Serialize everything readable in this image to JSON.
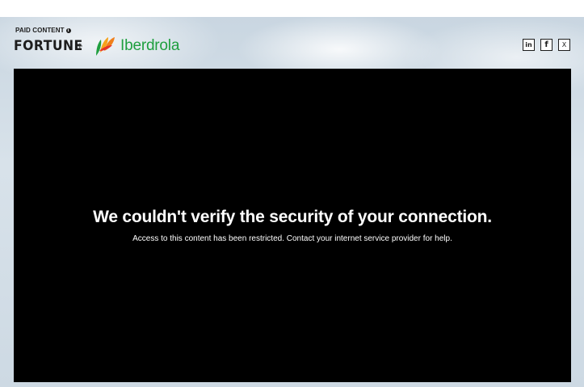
{
  "header": {
    "paid_label": "PAID CONTENT",
    "info_icon": "info-icon",
    "fortune_logo": "FORTUNE",
    "separator": "+",
    "partner_logo": "Iberdrola",
    "brand_green": "#1f9f3f"
  },
  "share": {
    "linkedin": "in",
    "facebook": "f",
    "x": "X"
  },
  "player": {
    "error_title": "We couldn't verify the security of your connection.",
    "error_message": "Access to this content has been restricted. Contact your internet service provider for help."
  }
}
